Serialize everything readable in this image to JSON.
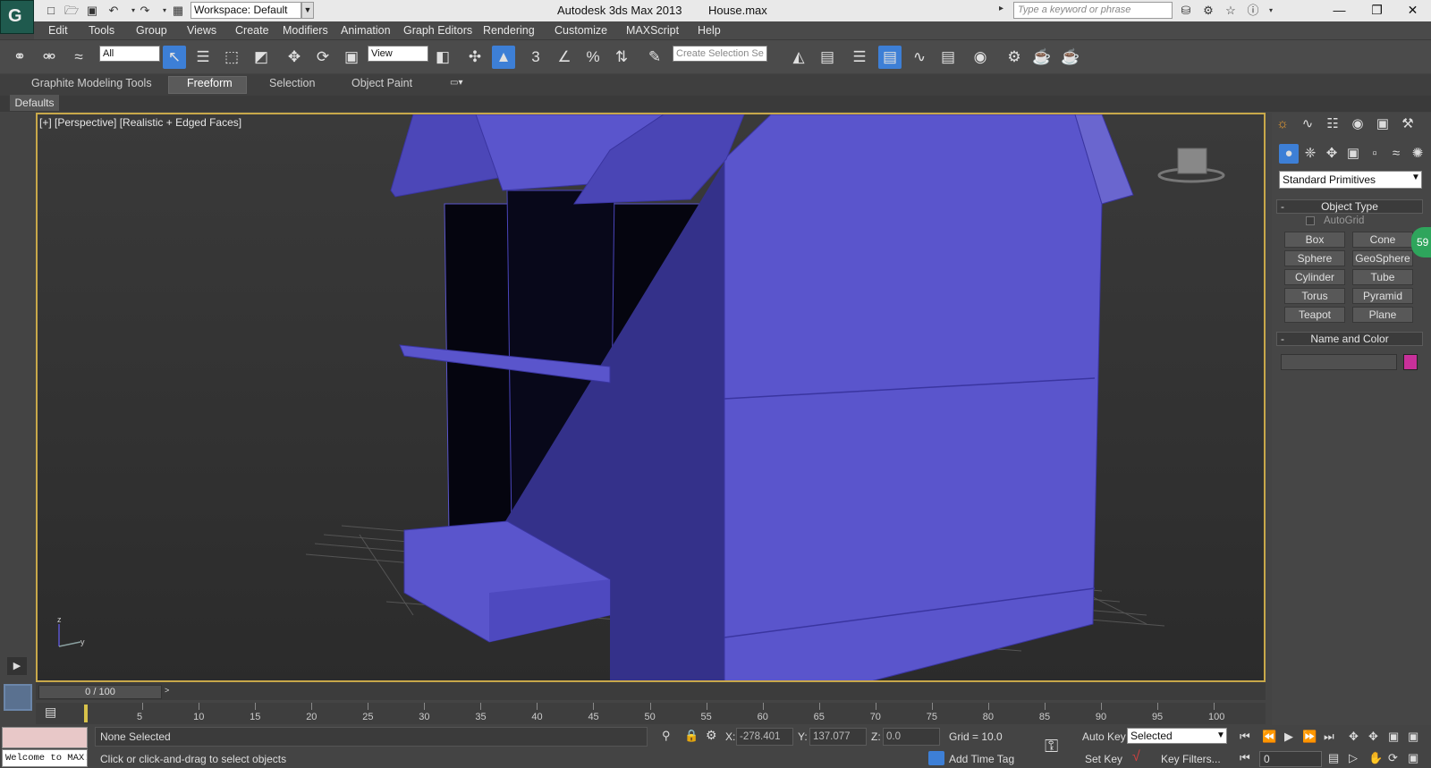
{
  "titlebar": {
    "workspace": "Workspace: Default",
    "app_title": "Autodesk 3ds Max  2013",
    "file_name": "House.max",
    "search_placeholder": "Type a keyword or phrase"
  },
  "menu": [
    "Edit",
    "Tools",
    "Group",
    "Views",
    "Create",
    "Modifiers",
    "Animation",
    "Graph Editors",
    "Rendering",
    "Customize",
    "MAXScript",
    "Help"
  ],
  "toolbar": {
    "selection_filter": "All",
    "reference_coord": "View",
    "named_selection_placeholder": "Create Selection Se",
    "snap_3d_label": "3"
  },
  "ribbon": {
    "tabs": [
      "Graphite Modeling Tools",
      "Freeform",
      "Selection",
      "Object Paint"
    ],
    "active_tab": "Freeform",
    "subpanel": "Defaults"
  },
  "viewport": {
    "label": "[+] [Perspective] [Realistic + Edged Faces]",
    "model_color": "#5a55cc",
    "axis_labels": {
      "z": "z",
      "y": "y"
    }
  },
  "command_panel": {
    "category_dropdown": "Standard Primitives",
    "object_type_header": "Object Type",
    "autogrid_label": "AutoGrid",
    "primitives": [
      "Box",
      "Cone",
      "Sphere",
      "GeoSphere",
      "Cylinder",
      "Tube",
      "Torus",
      "Pyramid",
      "Teapot",
      "Plane"
    ],
    "name_color_header": "Name and Color",
    "object_color": "#c8309a",
    "badge_value": "59"
  },
  "timeline": {
    "slider_label": "0 / 100",
    "ticks": [
      5,
      10,
      15,
      20,
      25,
      30,
      35,
      40,
      45,
      50,
      55,
      60,
      65,
      70,
      75,
      80,
      85,
      90,
      95,
      100
    ]
  },
  "status": {
    "maxscript_text": "Welcome to MAX!",
    "selection_status": "None Selected",
    "prompt": "Click or click-and-drag to select objects",
    "x_label": "X:",
    "x_value": "-278.401",
    "y_label": "Y:",
    "y_value": "137.077",
    "z_label": "Z:",
    "z_value": "0.0",
    "grid": "Grid = 10.0",
    "add_time_tag": "Add Time Tag",
    "auto_key": "Auto Key",
    "auto_key_mode": "Selected",
    "set_key": "Set Key",
    "key_filters": "Key Filters...",
    "current_frame": "0"
  }
}
